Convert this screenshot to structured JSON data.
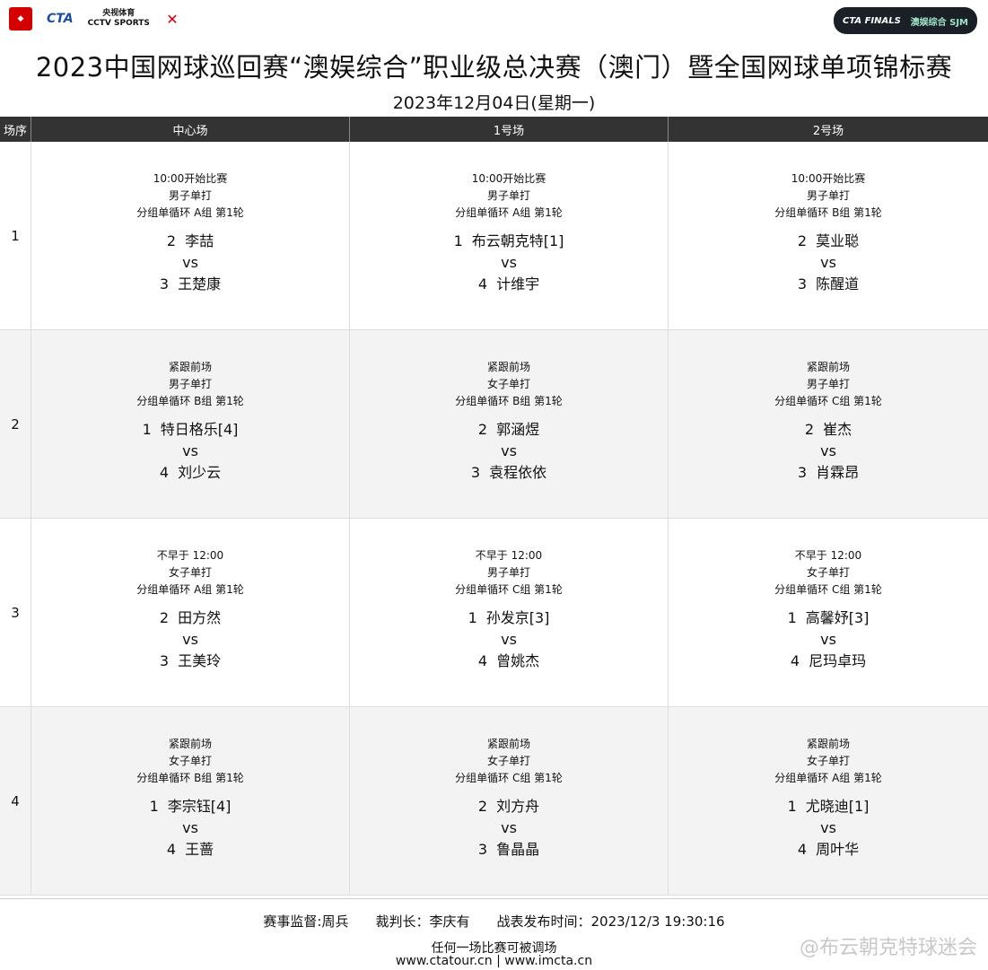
{
  "header": {
    "logos": [
      "CTA",
      "央视体育",
      "CCTV SPORTS"
    ],
    "right_logo": [
      "CTA FINALS",
      "澳娱综合 SJM"
    ],
    "title": "2023中国网球巡回赛“澳娱综合”职业级总决赛（澳门）暨全国网球单项锦标赛",
    "date": "2023年12月04日(星期一)"
  },
  "table": {
    "columns": [
      "场序",
      "中心场",
      "1号场",
      "2号场"
    ],
    "rows": [
      {
        "seq": "1",
        "matches": [
          {
            "time": "10:00开始比赛",
            "event": "男子单打",
            "round": "分组单循环 A组 第1轮",
            "p1_seed": "2",
            "p1": "李喆",
            "vs": "vs",
            "p2_seed": "3",
            "p2": "王楚康"
          },
          {
            "time": "10:00开始比赛",
            "event": "男子单打",
            "round": "分组单循环 A组 第1轮",
            "p1_seed": "1",
            "p1": "布云朝克特[1]",
            "vs": "vs",
            "p2_seed": "4",
            "p2": "计维宇"
          },
          {
            "time": "10:00开始比赛",
            "event": "男子单打",
            "round": "分组单循环 B组 第1轮",
            "p1_seed": "2",
            "p1": "莫业聪",
            "vs": "vs",
            "p2_seed": "3",
            "p2": "陈醒道"
          }
        ]
      },
      {
        "seq": "2",
        "matches": [
          {
            "time": "紧跟前场",
            "event": "男子单打",
            "round": "分组单循环 B组 第1轮",
            "p1_seed": "1",
            "p1": "特日格乐[4]",
            "vs": "vs",
            "p2_seed": "4",
            "p2": "刘少云"
          },
          {
            "time": "紧跟前场",
            "event": "女子单打",
            "round": "分组单循环 B组 第1轮",
            "p1_seed": "2",
            "p1": "郭涵煜",
            "vs": "vs",
            "p2_seed": "3",
            "p2": "袁程依依"
          },
          {
            "time": "紧跟前场",
            "event": "男子单打",
            "round": "分组单循环 C组 第1轮",
            "p1_seed": "2",
            "p1": "崔杰",
            "vs": "vs",
            "p2_seed": "3",
            "p2": "肖霖昂"
          }
        ]
      },
      {
        "seq": "3",
        "matches": [
          {
            "time": "不早于 12:00",
            "event": "女子单打",
            "round": "分组单循环 A组 第1轮",
            "p1_seed": "2",
            "p1": "田方然",
            "vs": "vs",
            "p2_seed": "3",
            "p2": "王美玲"
          },
          {
            "time": "不早于 12:00",
            "event": "男子单打",
            "round": "分组单循环 C组 第1轮",
            "p1_seed": "1",
            "p1": "孙发京[3]",
            "vs": "vs",
            "p2_seed": "4",
            "p2": "曾姚杰"
          },
          {
            "time": "不早于 12:00",
            "event": "女子单打",
            "round": "分组单循环 C组 第1轮",
            "p1_seed": "1",
            "p1": "高馨妤[3]",
            "vs": "vs",
            "p2_seed": "4",
            "p2": "尼玛卓玛"
          }
        ]
      },
      {
        "seq": "4",
        "matches": [
          {
            "time": "紧跟前场",
            "event": "女子单打",
            "round": "分组单循环 B组 第1轮",
            "p1_seed": "1",
            "p1": "李宗钰[4]",
            "vs": "vs",
            "p2_seed": "4",
            "p2": "王蔷"
          },
          {
            "time": "紧跟前场",
            "event": "女子单打",
            "round": "分组单循环 C组 第1轮",
            "p1_seed": "2",
            "p1": "刘方舟",
            "vs": "vs",
            "p2_seed": "3",
            "p2": "鲁晶晶"
          },
          {
            "time": "紧跟前场",
            "event": "女子单打",
            "round": "分组单循环 A组 第1轮",
            "p1_seed": "1",
            "p1": "尤晓迪[1]",
            "vs": "vs",
            "p2_seed": "4",
            "p2": "周叶华"
          }
        ]
      }
    ]
  },
  "footer": {
    "supervisor": "赛事监督:周兵",
    "referee": "裁判长：李庆有",
    "published": "战表发布时间：2023/12/3 19:30:16",
    "note": "任何一场比赛可被调场",
    "urls": "www.ctatour.cn | www.imcta.cn",
    "watermark": "@布云朝克特球迷会"
  }
}
